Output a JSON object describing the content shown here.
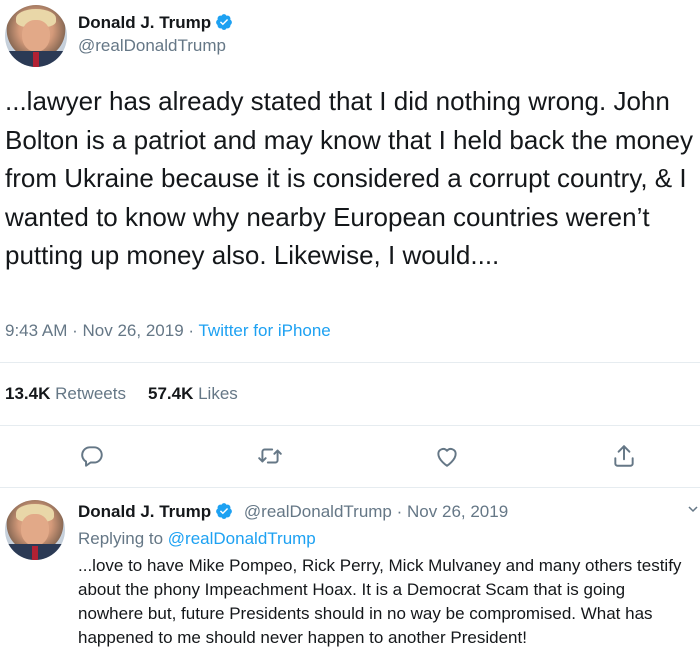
{
  "main_tweet": {
    "author_name": "Donald J. Trump",
    "author_handle": "@realDonaldTrump",
    "text": "...lawyer has already stated that I did nothing wrong. John Bolton is a patriot and may know that I held back the money from Ukraine because it is considered a corrupt country, & I wanted to know why nearby European countries weren’t putting up money also. Likewise, I would....",
    "time": "9:43 AM",
    "separator": "·",
    "date": "Nov 26, 2019",
    "source": "Twitter for iPhone",
    "retweets_count": "13.4K",
    "retweets_label": "Retweets",
    "likes_count": "57.4K",
    "likes_label": "Likes"
  },
  "actions": [
    "reply-icon",
    "retweet-icon",
    "like-icon",
    "share-icon"
  ],
  "reply_tweet": {
    "author_name": "Donald J. Trump",
    "author_handle": "@realDonaldTrump",
    "separator": "·",
    "date": "Nov 26, 2019",
    "replying_label": "Replying to",
    "replying_to": "@realDonaldTrump",
    "text": "...love to have Mike Pompeo, Rick Perry, Mick Mulvaney and many others testify about the phony Impeachment Hoax. It is a Democrat Scam that is going nowhere but, future Presidents should in no way be compromised. What has happened to me should never happen to another President!"
  },
  "colors": {
    "accent": "#1da1f2",
    "text": "#14171a",
    "secondary": "#657786",
    "divider": "#e6ecf0"
  }
}
